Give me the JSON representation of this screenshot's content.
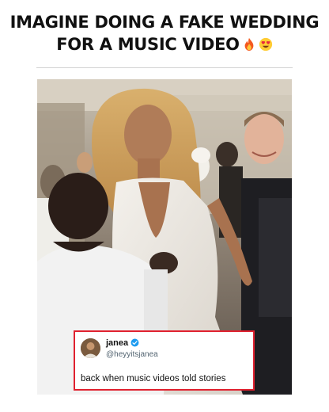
{
  "post": {
    "headline_line1": "IMAGINE DOING A FAKE WEDDING",
    "headline_line2": "FOR A MUSIC VIDEO",
    "headline_emojis": [
      "fire-emoji",
      "heart-eyes-emoji"
    ]
  },
  "photo": {
    "subject": "wedding-scene-photo"
  },
  "tweet": {
    "display_name": "janea",
    "verified": true,
    "handle": "@heyyitsjanea",
    "text": "back when music videos told stories",
    "border_color": "#e0212f",
    "verified_color": "#1d9bf0"
  }
}
